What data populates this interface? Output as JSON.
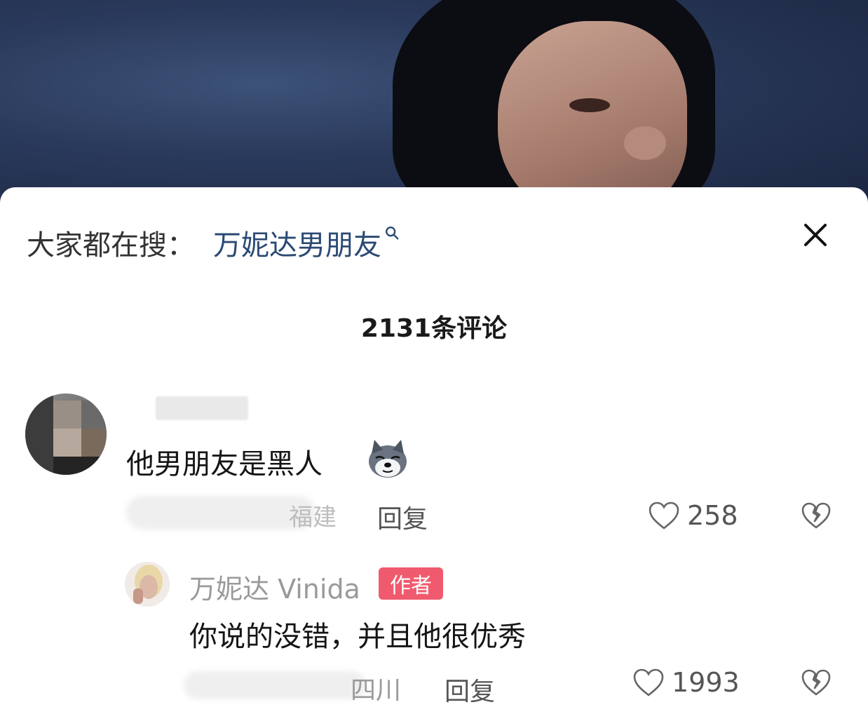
{
  "search_hint": {
    "prefix": "大家都在搜：",
    "keyword": "万妮达男朋友"
  },
  "comments_header": {
    "title": "2131条评论"
  },
  "comments": [
    {
      "text": "他男朋友是黑人",
      "location": "福建",
      "reply_label": "回复",
      "likes": "258"
    },
    {
      "author": "万妮达 Vinida",
      "badge": "作者",
      "text": "你说的没错，并且他很优秀",
      "location": "四川",
      "reply_label": "回复",
      "likes": "1993"
    }
  ],
  "colors": {
    "keyword": "#2b4a74",
    "badge": "#f05a6e",
    "muted": "#9a9a9a"
  },
  "icons": [
    "search-icon",
    "close-icon",
    "heart-icon",
    "broken-heart-icon",
    "husky-emoji-icon"
  ]
}
